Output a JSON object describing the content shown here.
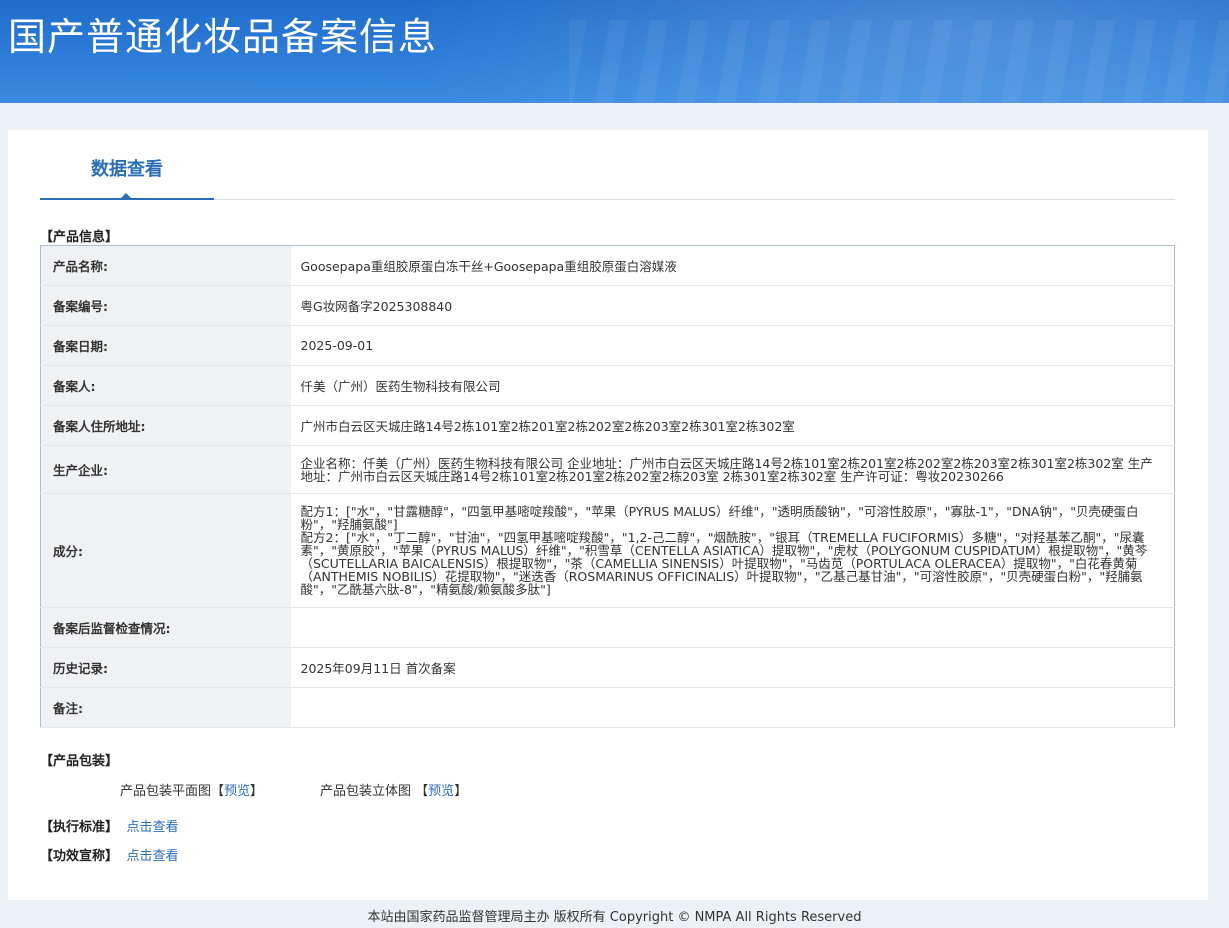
{
  "header": {
    "title": "国产普通化妆品备案信息"
  },
  "tab": {
    "label": "数据查看"
  },
  "product_section": {
    "label": "【产品信息】"
  },
  "rows": [
    {
      "k": "产品名称:",
      "v": [
        "Goosepapa重组胶原蛋白冻干丝+Goosepapa重组胶原蛋白溶媒液"
      ]
    },
    {
      "k": "备案编号:",
      "v": [
        "粤G妆网备字2025308840"
      ]
    },
    {
      "k": "备案日期:",
      "v": [
        "2025-09-01"
      ]
    },
    {
      "k": "备案人:",
      "v": [
        "仟美（广州）医药生物科技有限公司"
      ]
    },
    {
      "k": "备案人住所地址:",
      "v": [
        "广州市白云区天城庄路14号2栋101室2栋201室2栋202室2栋203室2栋301室2栋302室"
      ]
    },
    {
      "k": "生产企业:",
      "v": [
        "企业名称：仟美（广州）医药生物科技有限公司 企业地址：广州市白云区天城庄路14号2栋101室2栋201室2栋202室2栋203室2栋301室2栋302室 生产地址：广州市白云区天城庄路14号2栋101室2栋201室2栋202室2栋203室 2栋301室2栋302室 生产许可证：粤妆20230266"
      ]
    },
    {
      "k": "成分:",
      "v": [
        "配方1：[\"水\"，\"甘露糖醇\"，\"四氢甲基嘧啶羧酸\"，\"苹果（PYRUS MALUS）纤维\"，\"透明质酸钠\"，\"可溶性胶原\"，\"寡肽-1\"，\"DNA钠\"，\"贝壳硬蛋白粉\"，\"羟脯氨酸\"]",
        "配方2：[\"水\"，\"丁二醇\"，\"甘油\"，\"四氢甲基嘧啶羧酸\"，\"1,2-己二醇\"，\"烟酰胺\"，\"银耳（TREMELLA FUCIFORMIS）多糖\"，\"对羟基苯乙酮\"，\"尿囊素\"，\"黄原胶\"，\"苹果（PYRUS MALUS）纤维\"，\"积雪草（CENTELLA ASIATICA）提取物\"，\"虎杖（POLYGONUM CUSPIDATUM）根提取物\"，\"黄芩（SCUTELLARIA BAICALENSIS）根提取物\"，\"茶（CAMELLIA SINENSIS）叶提取物\"，\"马齿苋（PORTULACA OLERACEA）提取物\"，\"白花春黄菊（ANTHEMIS NOBILIS）花提取物\"，\"迷迭香（ROSMARINUS OFFICINALIS）叶提取物\"，\"乙基己基甘油\"，\"可溶性胶原\"，\"贝壳硬蛋白粉\"，\"羟脯氨酸\"，\"乙酰基六肽-8\"，\"精氨酸/赖氨酸多肽\"]"
      ]
    },
    {
      "k": "备案后监督检查情况:",
      "v": [
        ""
      ]
    },
    {
      "k": "历史记录:",
      "v": [
        "2025年09月11日 首次备案"
      ]
    },
    {
      "k": "备注:",
      "v": [
        ""
      ]
    }
  ],
  "packaging": {
    "label": "【产品包装】",
    "flat_label": "产品包装平面图",
    "flat_link": "预览",
    "solid_label": "产品包装立体图",
    "solid_link": "预览",
    "bracket_open": "【",
    "bracket_close": "】"
  },
  "standard": {
    "label": "【执行标准】",
    "link": "点击查看"
  },
  "efficacy": {
    "label": "【功效宣称】",
    "link": "点击查看"
  },
  "footer": {
    "text": "本站由国家药品监督管理局主办 版权所有 Copyright © NMPA All Rights Reserved"
  }
}
